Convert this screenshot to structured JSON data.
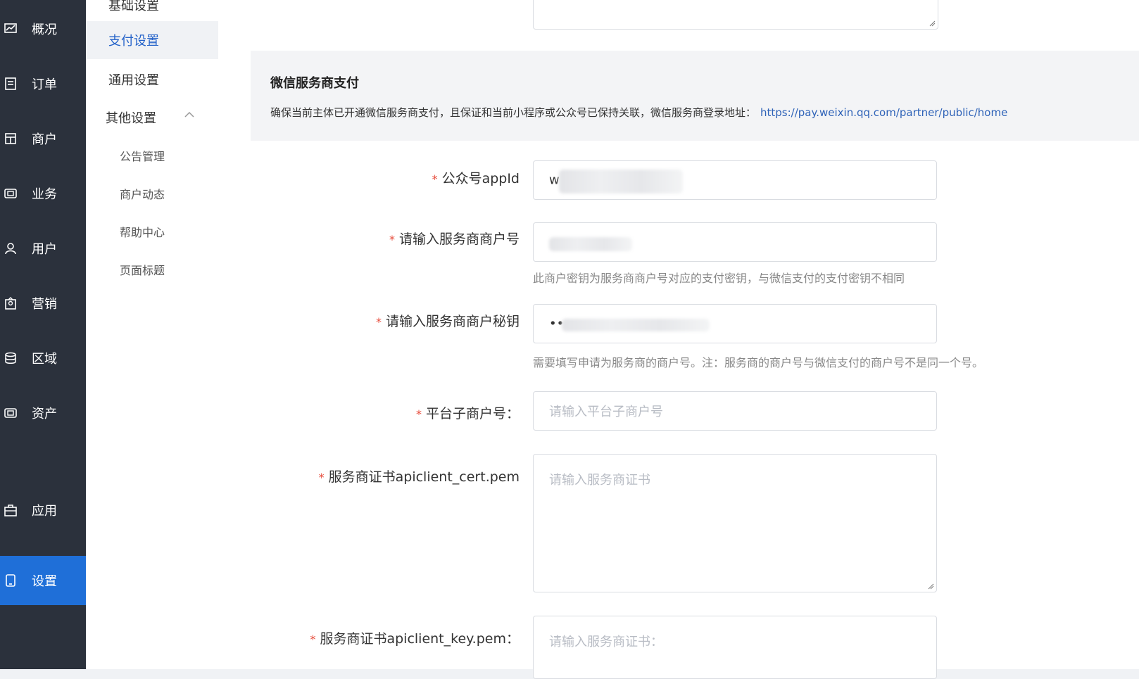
{
  "sidebar": {
    "items": [
      {
        "label": "概况",
        "icon": "chart-icon"
      },
      {
        "label": "订单",
        "icon": "order-icon"
      },
      {
        "label": "商户",
        "icon": "merchant-icon"
      },
      {
        "label": "业务",
        "icon": "business-icon"
      },
      {
        "label": "用户",
        "icon": "user-icon"
      },
      {
        "label": "营销",
        "icon": "marketing-icon"
      },
      {
        "label": "区域",
        "icon": "database-icon"
      },
      {
        "label": "资产",
        "icon": "asset-icon"
      },
      {
        "label": "应用",
        "icon": "app-icon"
      },
      {
        "label": "设置",
        "icon": "settings-icon"
      }
    ],
    "active": "设置"
  },
  "submenu": {
    "items": [
      {
        "label": "基础设置"
      },
      {
        "label": "支付设置"
      },
      {
        "label": "通用设置"
      },
      {
        "label": "其他设置"
      }
    ],
    "children": [
      {
        "label": "公告管理"
      },
      {
        "label": "商户动态"
      },
      {
        "label": "帮助中心"
      },
      {
        "label": "页面标题"
      }
    ],
    "active": "支付设置"
  },
  "notice": {
    "title": "微信服务商支付",
    "description": "确保当前主体已开通微信服务商支付，且保证和当前小程序或公众号已保持关联，微信服务商登录地址：",
    "link": "https://pay.weixin.qq.com/partner/public/home"
  },
  "form": {
    "appid": {
      "label": "公众号appId",
      "value": "w"
    },
    "merchant_no": {
      "label": "请输入服务商商户号",
      "value": "",
      "hint": "此商户密钥为服务商商户号对应的支付密钥，与微信支付的支付密钥不相同"
    },
    "merchant_secret": {
      "label": "请输入服务商商户秘钥",
      "value": "••",
      "hint": "需要填写申请为服务商的商户号。注：服务商的商户号与微信支付的商户号不是同一个号。"
    },
    "sub_merchant": {
      "label": "平台子商户号：",
      "placeholder": "请输入平台子商户号"
    },
    "cert": {
      "label": "服务商证书apiclient_cert.pem",
      "placeholder": "请输入服务商证书"
    },
    "key": {
      "label": "服务商证书apiclient_key.pem：",
      "placeholder": "请输入服务商证书："
    }
  },
  "colors": {
    "sidebar_bg": "#2b313c",
    "active_bg": "#1f6fd8",
    "link": "#2f63b8",
    "required": "#e74c3c"
  }
}
